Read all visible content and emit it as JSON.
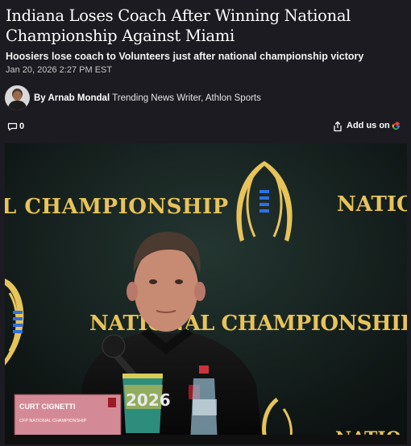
{
  "article": {
    "headline": "Indiana Loses Coach After Winning National Championship Against Miami",
    "subhead": "Hoosiers lose coach to Volunteers just after national championship victory",
    "timestamp": "Jan 20, 2026 2:27 PM EST"
  },
  "author": {
    "prefix": "By ",
    "name": "Arnab Mondal",
    "role": " Trending News Writer, Athlon Sports"
  },
  "actions": {
    "comment_count": "0",
    "add_us_label": "Add us on"
  },
  "photo": {
    "backdrop_left_text": "L CHAMPIONSHIP",
    "backdrop_right_text": "NATIO",
    "backdrop_mid_text": "NATIONAL CHAMPIONSHIP",
    "backdrop_bottom_text": "NATIO",
    "nameplate_name": "CURT CIGNETTI",
    "nameplate_sub": "CFP NATIONAL CHAMPIONSHIP",
    "cup_text": "2026"
  },
  "colors": {
    "background": "#1b1b21",
    "gold": "#e7c35a",
    "logo_blue": "#2f6fe3"
  }
}
